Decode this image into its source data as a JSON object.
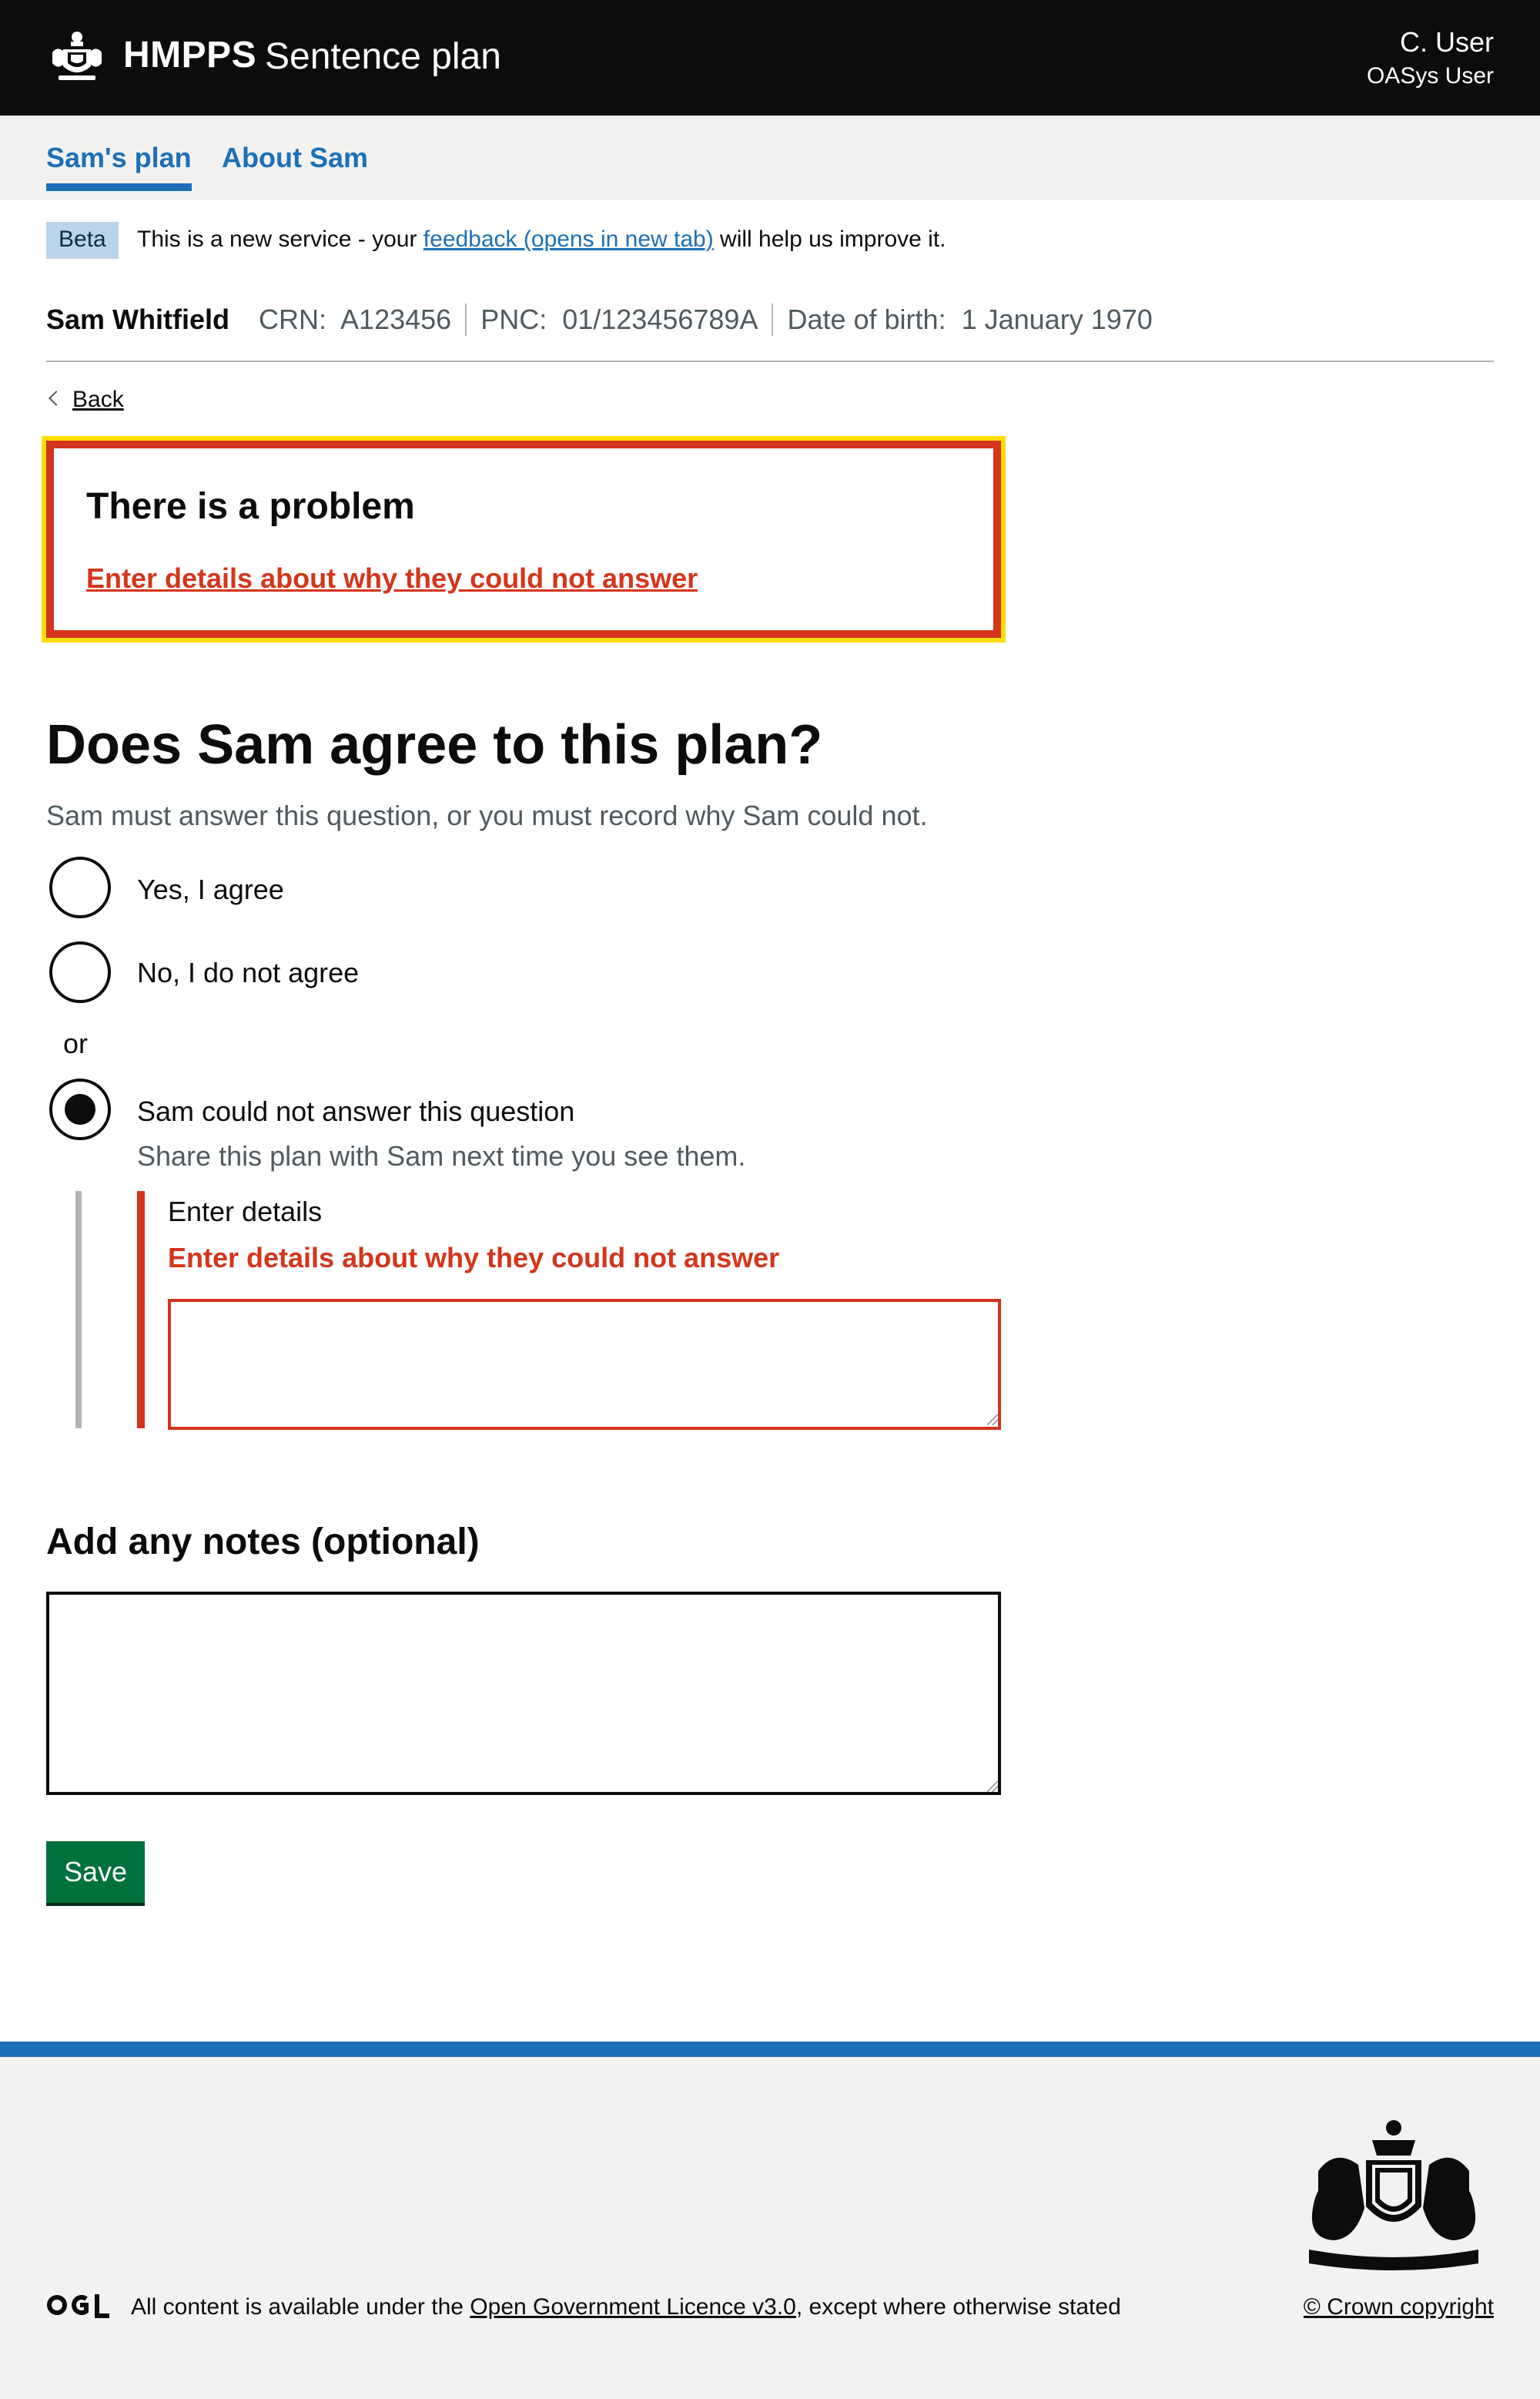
{
  "header": {
    "brand": "HMPPS",
    "service": "Sentence plan",
    "user_name": "C. User",
    "user_role": "OASys User",
    "crest_icon": "crown-crest-icon"
  },
  "nav": {
    "tabs": [
      {
        "label": "Sam's plan",
        "active": true
      },
      {
        "label": "About Sam",
        "active": false
      }
    ]
  },
  "phase_banner": {
    "tag": "Beta",
    "text_before": "This is a new service - your",
    "link": "feedback (opens in new tab)",
    "text_after": "will help us improve it."
  },
  "person": {
    "name": "Sam Whitfield",
    "crn_label": "CRN:",
    "crn": "A123456",
    "pnc_label": "PNC:",
    "pnc": "01/123456789A",
    "dob_label": "Date of birth:",
    "dob": "1 January 1970"
  },
  "back_link": "Back",
  "error_summary": {
    "title": "There is a problem",
    "link": "Enter details about why they could not answer"
  },
  "question": {
    "heading": "Does Sam agree to this plan?",
    "hint": "Sam must answer this question, or you must record why Sam could not.",
    "options": [
      {
        "label": "Yes, I agree",
        "checked": false
      },
      {
        "label": "No, I do not agree",
        "checked": false
      },
      {
        "label": "Sam could not answer this question",
        "checked": true,
        "hint": "Share this plan with Sam next time you see them."
      }
    ],
    "divider": "or",
    "details_label": "Enter details",
    "details_error": "Enter details about why they could not answer",
    "details_value": ""
  },
  "notes": {
    "heading": "Add any notes (optional)",
    "value": ""
  },
  "save_button": "Save",
  "footer": {
    "licence_before": "All content is available under the",
    "licence_link": "Open Government Licence v3.0",
    "licence_after": ", except where otherwise stated",
    "copyright": "© Crown copyright",
    "ogl_logo": "OGL"
  },
  "colors": {
    "header_bg": "#0b0c0c",
    "link": "#1d70b8",
    "error": "#d4351c",
    "focus": "#ffdd00",
    "button": "#00703c",
    "footer_bg": "#f3f2f1"
  }
}
